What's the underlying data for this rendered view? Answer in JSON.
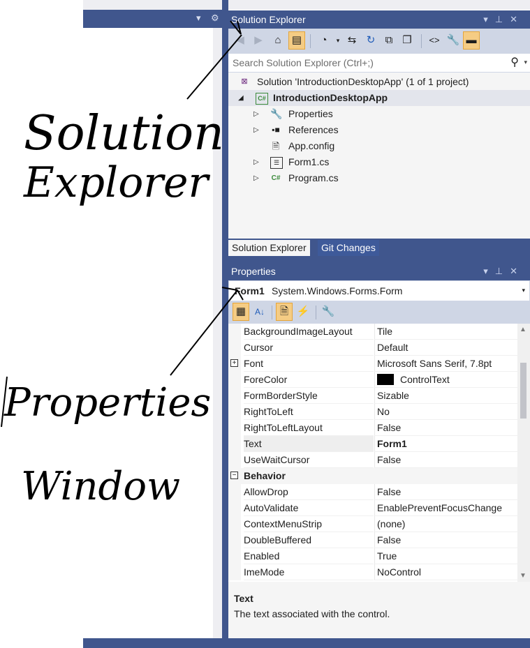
{
  "solution_explorer": {
    "title": "Solution Explorer",
    "header_icons": [
      "dropdown-arrow",
      "pin",
      "close"
    ],
    "search_placeholder": "Search Solution Explorer (Ctrl+;)",
    "tree": [
      {
        "label": "Solution 'IntroductionDesktopApp' (1 of 1 project)",
        "icon": "vs-solution-icon",
        "level": 0,
        "expander": "none"
      },
      {
        "label": "IntroductionDesktopApp",
        "icon": "csharp-project-icon",
        "level": 1,
        "expander": "expanded",
        "bold": true,
        "selected": true
      },
      {
        "label": "Properties",
        "icon": "wrench-icon",
        "level": 2,
        "expander": "collapsed"
      },
      {
        "label": "References",
        "icon": "references-icon",
        "level": 2,
        "expander": "collapsed"
      },
      {
        "label": "App.config",
        "icon": "config-file-icon",
        "level": 2,
        "expander": "none"
      },
      {
        "label": "Form1.cs",
        "icon": "form-icon",
        "level": 2,
        "expander": "collapsed"
      },
      {
        "label": "Program.cs",
        "icon": "csharp-file-icon",
        "level": 2,
        "expander": "collapsed"
      }
    ],
    "tabs": [
      {
        "label": "Solution Explorer",
        "active": true
      },
      {
        "label": "Git Changes",
        "active": false
      }
    ]
  },
  "properties": {
    "title": "Properties",
    "object_name": "Form1",
    "object_type": "System.Windows.Forms.Form",
    "rows": [
      {
        "name": "BackgroundImageLayout",
        "value": "Tile"
      },
      {
        "name": "Cursor",
        "value": "Default"
      },
      {
        "name": "Font",
        "value": "Microsoft Sans Serif, 7.8pt",
        "expandable": true
      },
      {
        "name": "ForeColor",
        "value": "ControlText",
        "swatch": "#000000"
      },
      {
        "name": "FormBorderStyle",
        "value": "Sizable"
      },
      {
        "name": "RightToLeft",
        "value": "No"
      },
      {
        "name": "RightToLeftLayout",
        "value": "False"
      },
      {
        "name": "Text",
        "value": "Form1",
        "bold_value": true,
        "selected": true
      },
      {
        "name": "UseWaitCursor",
        "value": "False"
      },
      {
        "name": "Behavior",
        "category": true
      },
      {
        "name": "AllowDrop",
        "value": "False"
      },
      {
        "name": "AutoValidate",
        "value": "EnablePreventFocusChange"
      },
      {
        "name": "ContextMenuStrip",
        "value": "(none)"
      },
      {
        "name": "DoubleBuffered",
        "value": "False"
      },
      {
        "name": "Enabled",
        "value": "True"
      },
      {
        "name": "ImeMode",
        "value": "NoControl"
      }
    ],
    "description_title": "Text",
    "description_text": "The text associated with the control."
  },
  "annotations": {
    "solution_explorer_label": [
      "Solution",
      "Explorer"
    ],
    "properties_label": [
      "Properties",
      "Window"
    ]
  },
  "colors": {
    "vs_blue": "#40568d",
    "toolbar": "#cfd6e5",
    "selection": "#f5cc84"
  }
}
